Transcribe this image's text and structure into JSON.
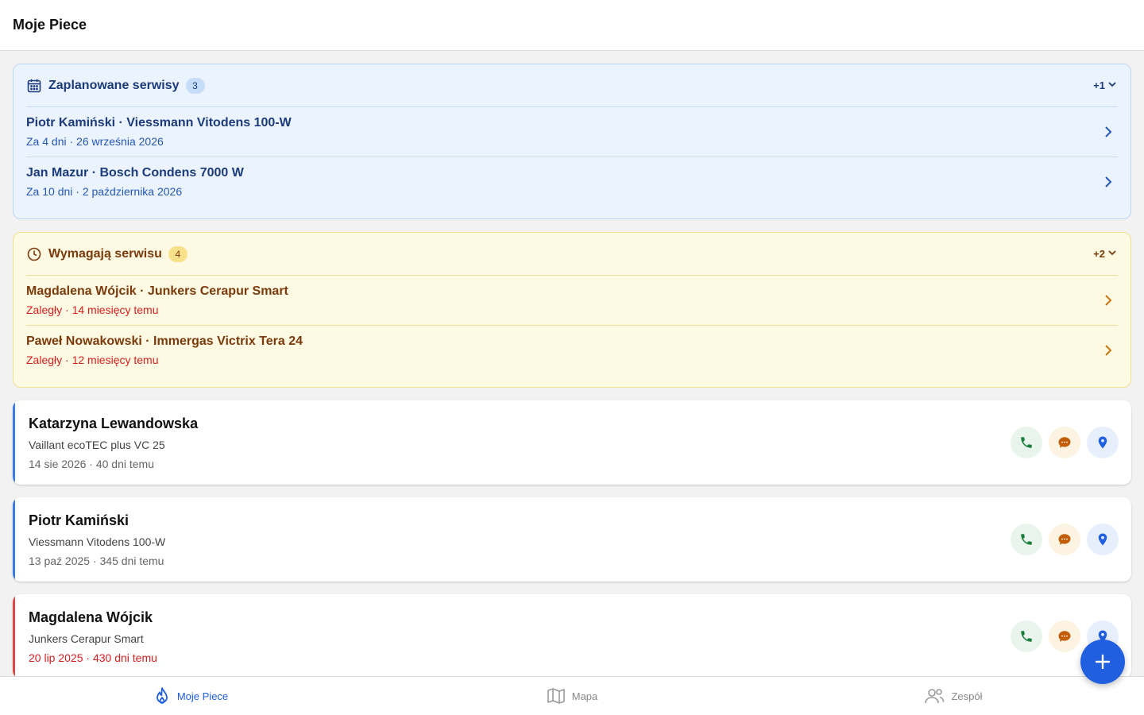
{
  "header": {
    "title": "Moje Piece"
  },
  "scheduled": {
    "title": "Zaplanowane serwisy",
    "count": "3",
    "more": "+1",
    "items": [
      {
        "title": "Piotr Kamiński · Viessmann Vitodens 100-W",
        "subtitle": "Za 4 dni · 26 września 2026"
      },
      {
        "title": "Jan Mazur · Bosch Condens 7000 W",
        "subtitle": "Za 10 dni · 2 października 2026"
      }
    ]
  },
  "needs_service": {
    "title": "Wymagają serwisu",
    "count": "4",
    "more": "+2",
    "items": [
      {
        "title": "Magdalena Wójcik · Junkers Cerapur Smart",
        "subtitle": "Zaległy · 14 miesięcy temu"
      },
      {
        "title": "Paweł Nowakowski · Immergas Victrix Tera 24",
        "subtitle": "Zaległy · 12 miesięcy temu"
      }
    ]
  },
  "cards": [
    {
      "name": "Katarzyna Lewandowska",
      "model": "Vaillant ecoTEC plus VC 25",
      "date": "14 sie 2026 · 40 dni temu",
      "accent": "#3b7be6"
    },
    {
      "name": "Piotr Kamiński",
      "model": "Viessmann Vitodens 100-W",
      "date": "13 paź 2025 · 345 dni temu",
      "accent": "#3b7be6"
    },
    {
      "name": "Magdalena Wójcik",
      "model": "Junkers Cerapur Smart",
      "date": "20 lip 2025 · 430 dni temu",
      "accent": "#e04545"
    }
  ],
  "nav": {
    "items": [
      {
        "label": "Moje Piece",
        "icon": "flame-icon"
      },
      {
        "label": "Mapa",
        "icon": "map-icon"
      },
      {
        "label": "Zespół",
        "icon": "users-icon"
      }
    ]
  },
  "colors": {
    "primary": "#1f5fe0",
    "scheduled_bg": "#eaf3fe",
    "warning_bg": "#fef9e2",
    "overdue_text": "#d42020"
  }
}
